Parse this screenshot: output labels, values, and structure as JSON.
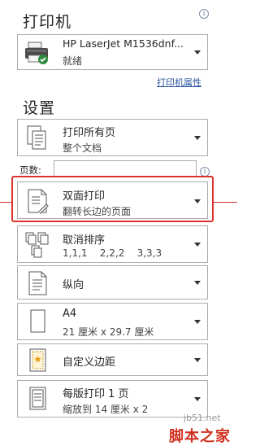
{
  "print_section": {
    "title": "打印机",
    "printer": {
      "name": "HP LaserJet M1536dnf...",
      "status": "就绪",
      "properties_link": "打印机属性"
    }
  },
  "settings": {
    "title": "设置",
    "scope": {
      "label": "打印所有页",
      "sub": "整个文档"
    },
    "pages": {
      "label": "页数:",
      "value": ""
    },
    "duplex": {
      "label": "双面打印",
      "sub": "翻转长边的页面",
      "highlight_color": "#d9342b"
    },
    "collate": {
      "label": "取消排序",
      "sub": "1,1,1    2,2,2    3,3,3"
    },
    "orientation": {
      "label": "纵向"
    },
    "paper": {
      "label": "A4",
      "sub": "21 厘米 x 29.7 厘米"
    },
    "margins": {
      "label": "自定义边距"
    },
    "pages_per_sheet": {
      "label": "每版打印 1 页",
      "sub": "缩放到 14 厘米 x 2"
    }
  },
  "info_glyph": "i",
  "watermark": {
    "site": "jb51.net",
    "brand": "脚本之家"
  }
}
